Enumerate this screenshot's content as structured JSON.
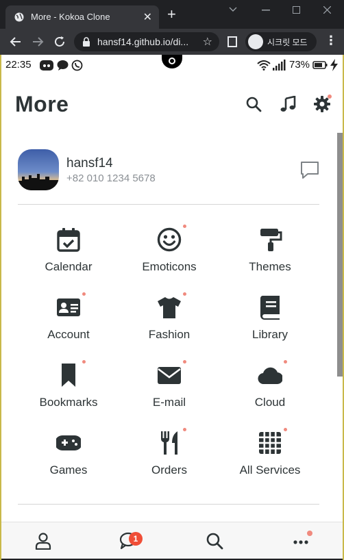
{
  "browser": {
    "tab_title": "More - Kokoa Clone",
    "url": "hansf14.github.io/di...",
    "incognito_label": "시크릿 모드",
    "new_tab": "+",
    "close": "✕"
  },
  "status_bar": {
    "time": "22:35",
    "battery": "73%"
  },
  "header": {
    "title": "More"
  },
  "profile": {
    "name": "hansf14",
    "phone": "+82 010 1234 5678"
  },
  "grid": [
    {
      "label": "Calendar",
      "icon": "calendar-icon",
      "dot": false
    },
    {
      "label": "Emoticons",
      "icon": "smile-icon",
      "dot": true
    },
    {
      "label": "Themes",
      "icon": "paint-roller-icon",
      "dot": false
    },
    {
      "label": "Account",
      "icon": "id-card-icon",
      "dot": true
    },
    {
      "label": "Fashion",
      "icon": "tshirt-icon",
      "dot": true
    },
    {
      "label": "Library",
      "icon": "book-icon",
      "dot": false
    },
    {
      "label": "Bookmarks",
      "icon": "bookmark-icon",
      "dot": true
    },
    {
      "label": "E-mail",
      "icon": "envelope-icon",
      "dot": true
    },
    {
      "label": "Cloud",
      "icon": "cloud-icon",
      "dot": true
    },
    {
      "label": "Games",
      "icon": "gamepad-icon",
      "dot": false
    },
    {
      "label": "Orders",
      "icon": "utensils-icon",
      "dot": true
    },
    {
      "label": "All Services",
      "icon": "grid-icon",
      "dot": true
    }
  ],
  "bottom_nav": {
    "chat_badge": "1"
  },
  "colors": {
    "icon": "#2d3436",
    "dot": "#f08a7e",
    "badge": "#f04e37"
  }
}
